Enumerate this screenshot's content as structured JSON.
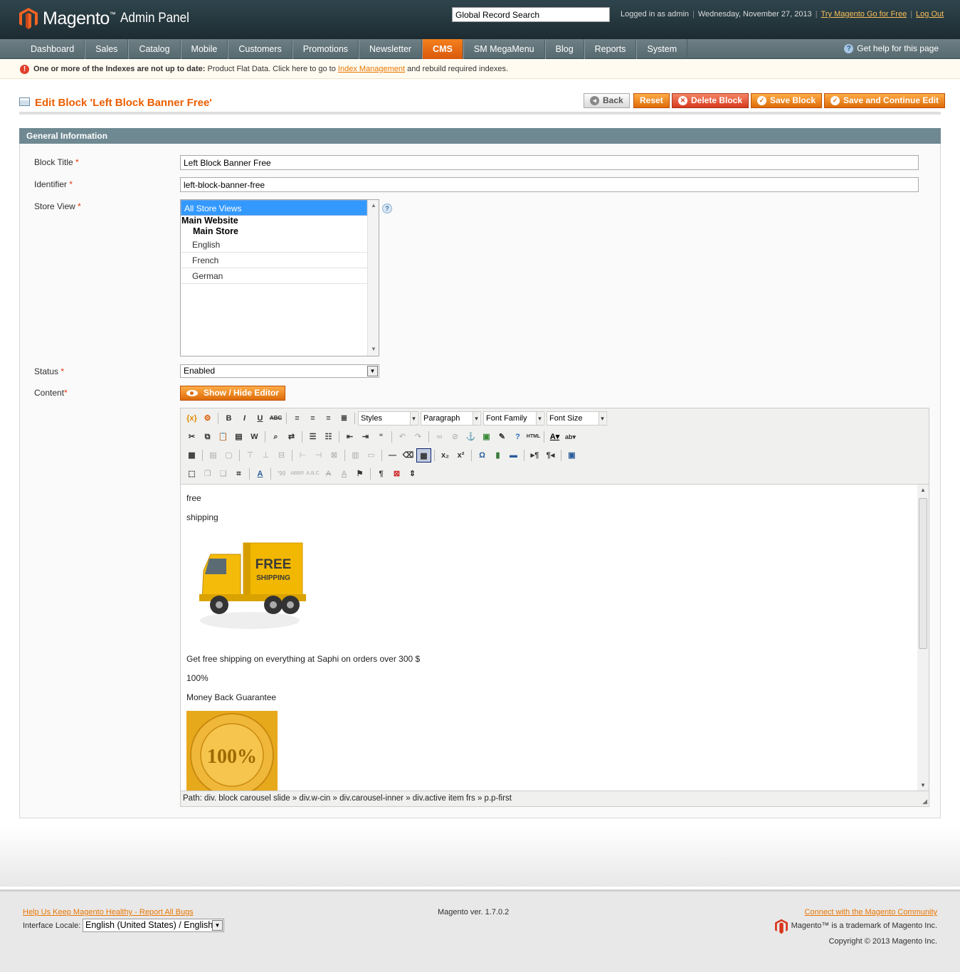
{
  "header": {
    "brand": "Magento",
    "brand_sub": "Admin Panel",
    "search_value": "Global Record Search",
    "logged_in": "Logged in as admin",
    "date": "Wednesday, November 27, 2013",
    "try_link": "Try Magento Go for Free",
    "logout": "Log Out"
  },
  "nav": {
    "items": [
      "Dashboard",
      "Sales",
      "Catalog",
      "Mobile",
      "Customers",
      "Promotions",
      "Newsletter",
      "CMS",
      "SM MegaMenu",
      "Blog",
      "Reports",
      "System"
    ],
    "active": "CMS",
    "help": "Get help for this page"
  },
  "notice": {
    "bold": "One or more of the Indexes are not up to date:",
    "text": " Product Flat Data. Click here to go to ",
    "link": "Index Management",
    "tail": " and rebuild required indexes."
  },
  "page": {
    "title": "Edit Block 'Left Block Banner Free'",
    "buttons": {
      "back": "Back",
      "reset": "Reset",
      "delete": "Delete Block",
      "save": "Save Block",
      "save_continue": "Save and Continue Edit"
    }
  },
  "section": {
    "title": "General Information"
  },
  "form": {
    "block_title_label": "Block Title",
    "block_title_value": "Left Block Banner Free",
    "identifier_label": "Identifier",
    "identifier_value": "left-block-banner-free",
    "store_view_label": "Store View",
    "store_options": {
      "all": "All Store Views",
      "website": "Main Website",
      "store": "Main Store",
      "views": [
        "English",
        "French",
        "German"
      ]
    },
    "status_label": "Status",
    "status_value": "Enabled",
    "content_label": "Content",
    "show_hide": "Show / Hide Editor",
    "req": "*"
  },
  "editor": {
    "styles": "Styles",
    "format": "Paragraph",
    "font_family": "Font Family",
    "font_size": "Font Size",
    "lines": [
      "free",
      "shipping",
      "Get free shipping on everything at Saphi on orders over 300 $",
      "100%",
      "Money Back Guarantee"
    ],
    "truck_text1": "FREE",
    "truck_text2": "SHIPPING",
    "badge_text": "100%",
    "path": "Path: div. block carousel slide » div.w-cin » div.carousel-inner » div.active item frs » p.p-first"
  },
  "footer": {
    "report_link": "Help Us Keep Magento Healthy - Report All Bugs",
    "locale_label": "Interface Locale:",
    "locale_value": "English (United States) / English",
    "version": "Magento ver. 1.7.0.2",
    "community_link": "Connect with the Magento Community",
    "trademark": "Magento™ is a trademark of Magento Inc.",
    "copyright": "Copyright © 2013 Magento Inc."
  },
  "colors": {
    "accent": "#eb5e00",
    "nav_active": "#e8700f",
    "section": "#6f8992"
  }
}
